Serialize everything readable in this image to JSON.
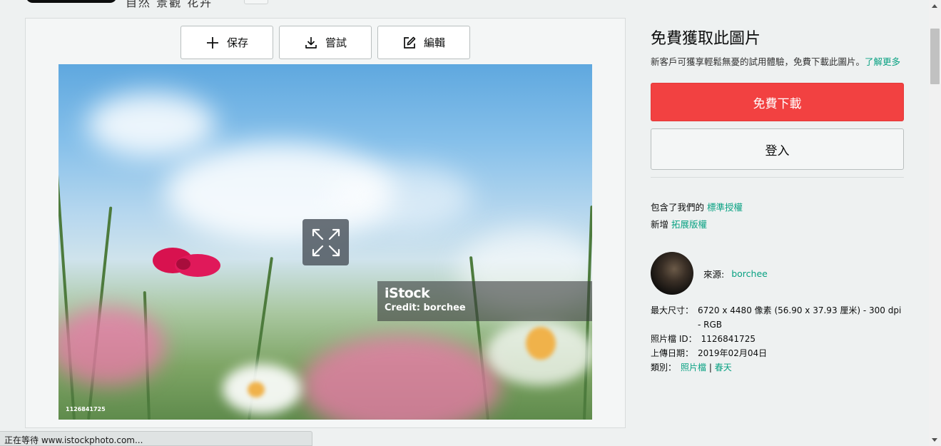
{
  "header": {
    "partial_title": "自然 景觀 花卉"
  },
  "toolbar": {
    "save_label": "保存",
    "try_label": "嘗試",
    "edit_label": "編輯"
  },
  "image": {
    "watermark_logo": "iStock",
    "watermark_credit": "Credit: borchee",
    "image_id": "1126841725"
  },
  "sidebar": {
    "title": "免費獲取此圖片",
    "description": "新客戶可獲享輕鬆無憂的試用體驗，免費下載此圖片。",
    "learn_more": "了解更多",
    "download_button": "免費下載",
    "login_button": "登入",
    "license_prefix": "包含了我們的",
    "license_link": "標準授權",
    "extended_prefix": "新增",
    "extended_link": "拓展版權",
    "author_label": "來源:",
    "author_name": "borchee",
    "meta": {
      "size_label": "最大尺寸：",
      "size_value": "6720 x 4480 像素 (56.90 x 37.93 厘米) - 300 dpi - RGB",
      "id_label": "照片檔 ID：",
      "id_value": "1126841725",
      "date_label": "上傳日期：",
      "date_value": "2019年02月04日",
      "category_label": "類別：",
      "category_1": "照片檔",
      "category_sep": "|",
      "category_2": "春天"
    }
  },
  "status": {
    "text": "正在等待 www.istockphoto.com..."
  },
  "colors": {
    "accent_link": "#08a182",
    "download_red": "#f24141"
  }
}
